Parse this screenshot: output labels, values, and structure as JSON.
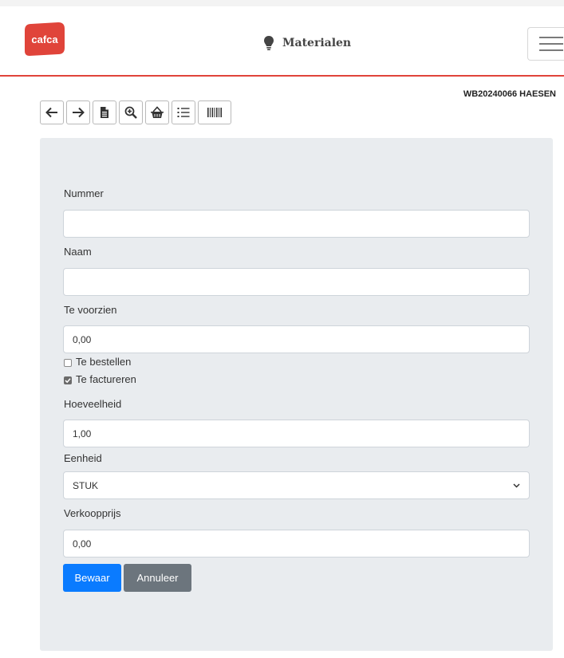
{
  "app": {
    "logo_text": "cafca",
    "brand_color": "#e0443a"
  },
  "header": {
    "title": "Materialen",
    "title_icon": "lightbulb-icon",
    "menu_icon": "hamburger-icon"
  },
  "job": {
    "id": "WB20240066 HAESEN"
  },
  "toolbar": [
    {
      "icon": "arrow-left-icon"
    },
    {
      "icon": "arrow-right-icon"
    },
    {
      "icon": "document-icon"
    },
    {
      "icon": "zoom-in-icon"
    },
    {
      "icon": "basket-icon"
    },
    {
      "icon": "list-icon"
    },
    {
      "icon": "barcode-icon"
    }
  ],
  "form": {
    "nummer": {
      "label": "Nummer",
      "value": ""
    },
    "naam": {
      "label": "Naam",
      "value": ""
    },
    "te_voorzien": {
      "label": "Te voorzien",
      "value": "0,00"
    },
    "te_bestellen": {
      "label": "Te bestellen",
      "checked": false
    },
    "te_factureren": {
      "label": "Te factureren",
      "checked": true
    },
    "hoeveelheid": {
      "label": "Hoeveelheid",
      "value": "1,00"
    },
    "eenheid": {
      "label": "Eenheid",
      "value": "STUK"
    },
    "verkoopprijs": {
      "label": "Verkoopprijs",
      "value": "0,00"
    },
    "save_label": "Bewaar",
    "cancel_label": "Annuleer"
  },
  "colors": {
    "primary": "#0a7bff",
    "secondary": "#6c757d",
    "panel": "#e9ecef"
  }
}
